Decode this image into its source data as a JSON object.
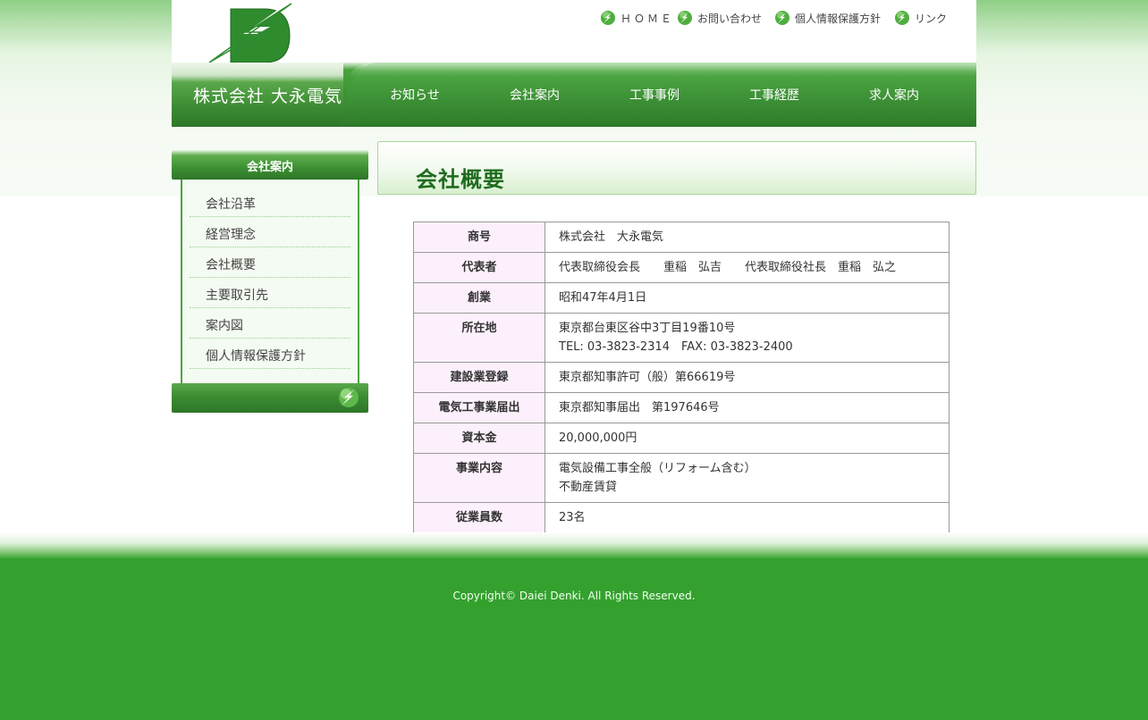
{
  "company_name": "株式会社 大永電気",
  "util_nav": [
    {
      "label": "ＨＯＭＥ",
      "icon": "bolt-ball-icon"
    },
    {
      "label": "お問い合わせ",
      "icon": "bolt-ball-icon"
    },
    {
      "label": "個人情報保護方針",
      "icon": "bolt-ball-icon"
    },
    {
      "label": "リンク",
      "icon": "bolt-ball-icon"
    }
  ],
  "main_nav": [
    "お知らせ",
    "会社案内",
    "工事事例",
    "工事経歴",
    "求人案内"
  ],
  "sidebar": {
    "heading": "会社案内",
    "items": [
      "会社沿革",
      "経営理念",
      "会社概要",
      "主要取引先",
      "案内図",
      "個人情報保護方針"
    ]
  },
  "page_title": "会社概要",
  "company_info": [
    {
      "label": "商号",
      "lines": [
        "株式会社　大永電気"
      ]
    },
    {
      "label": "代表者",
      "lines": [
        "代表取締役会長　　重稲　弘吉　　代表取締役社長　重稲　弘之"
      ]
    },
    {
      "label": "創業",
      "lines": [
        "昭和47年4月1日"
      ]
    },
    {
      "label": "所在地",
      "lines": [
        "東京都台東区谷中3丁目19番10号",
        "TEL: 03-3823-2314　FAX: 03-3823-2400"
      ]
    },
    {
      "label": "建設業登録",
      "lines": [
        "東京都知事許可（般）第66619号"
      ]
    },
    {
      "label": "電気工事業届出",
      "lines": [
        "東京都知事届出　第197646号"
      ]
    },
    {
      "label": "資本金",
      "lines": [
        "20,000,000円"
      ]
    },
    {
      "label": "事業内容",
      "lines": [
        "電気設備工事全般（リフォーム含む）",
        "不動産賃貸"
      ]
    },
    {
      "label": "従業員数",
      "lines": [
        "23名"
      ]
    }
  ],
  "footer": {
    "copyright": "Copyright© Daiei Denki. All Rights Reserved."
  },
  "colors": {
    "brand_green": "#34a12e",
    "nav_green": "#3c8f33",
    "label_bg": "#fdf0fd",
    "title_green": "#1f6b1f"
  }
}
